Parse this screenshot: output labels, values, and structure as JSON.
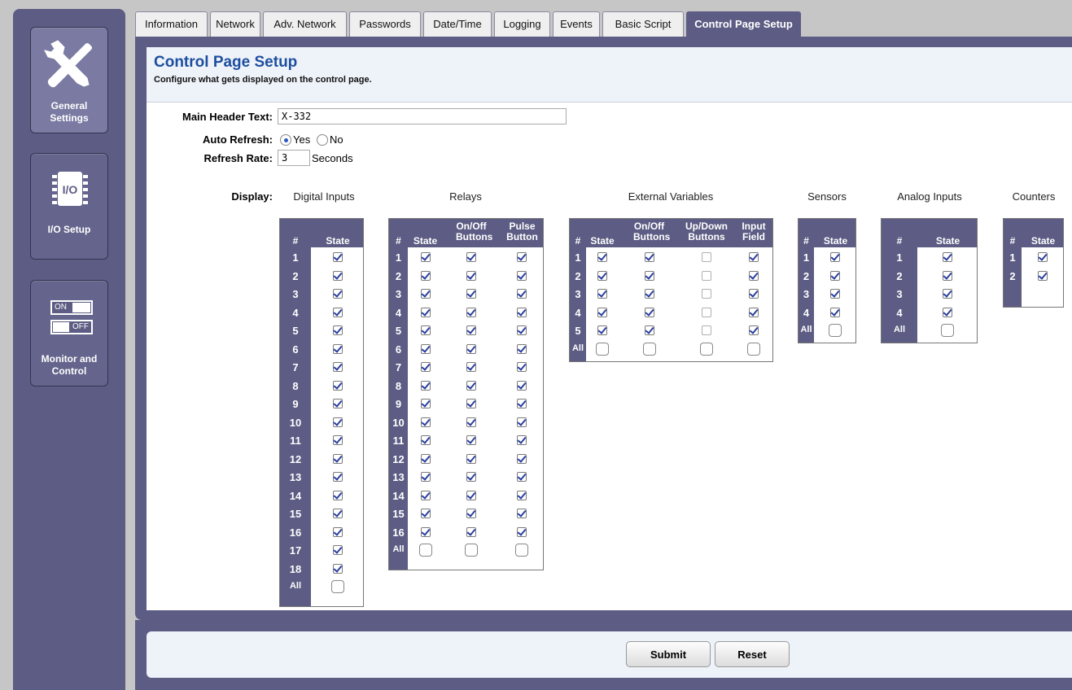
{
  "sidebar": {
    "items": [
      {
        "label": "General Settings",
        "icon": "tools-icon"
      },
      {
        "label": "I/O Setup",
        "icon": "io-chip-icon"
      },
      {
        "label": "Monitor and Control",
        "icon": "on-off-switch-icon",
        "switch_on": "ON",
        "switch_off": "OFF"
      }
    ]
  },
  "tabs": [
    {
      "label": "Information"
    },
    {
      "label": "Network"
    },
    {
      "label": "Adv. Network"
    },
    {
      "label": "Passwords"
    },
    {
      "label": "Date/Time"
    },
    {
      "label": "Logging"
    },
    {
      "label": "Events"
    },
    {
      "label": "Basic Script"
    },
    {
      "label": "Control Page Setup",
      "active": true
    }
  ],
  "page": {
    "title": "Control Page Setup",
    "subtitle": "Configure what gets displayed on the control page."
  },
  "form": {
    "main_header_label": "Main Header Text:",
    "main_header_value": "X-332",
    "auto_refresh_label": "Auto Refresh:",
    "auto_refresh_yes": "Yes",
    "auto_refresh_no": "No",
    "auto_refresh_selected": "Yes",
    "refresh_rate_label": "Refresh Rate:",
    "refresh_rate_value": "3",
    "refresh_rate_unit": "Seconds",
    "display_label": "Display:"
  },
  "groups": {
    "digital_inputs": {
      "title": "Digital Inputs",
      "columns": [
        "#",
        "State"
      ],
      "rows": [
        "1",
        "2",
        "3",
        "4",
        "5",
        "6",
        "7",
        "8",
        "9",
        "10",
        "11",
        "12",
        "13",
        "14",
        "15",
        "16",
        "17",
        "18"
      ],
      "all_label": "All"
    },
    "relays": {
      "title": "Relays",
      "columns": [
        "#",
        "State",
        "On/Off Buttons",
        "Pulse Button"
      ],
      "rows": [
        "1",
        "2",
        "3",
        "4",
        "5",
        "6",
        "7",
        "8",
        "9",
        "10",
        "11",
        "12",
        "13",
        "14",
        "15",
        "16"
      ],
      "all_label": "All"
    },
    "external_variables": {
      "title": "External Variables",
      "columns": [
        "#",
        "State",
        "On/Off Buttons",
        "Up/Down Buttons",
        "Input Field"
      ],
      "rows": [
        "1",
        "2",
        "3",
        "4",
        "5"
      ],
      "all_label": "All"
    },
    "sensors": {
      "title": "Sensors",
      "columns": [
        "#",
        "State"
      ],
      "rows": [
        "1",
        "2",
        "3",
        "4"
      ],
      "all_label": "All"
    },
    "analog_inputs": {
      "title": "Analog Inputs",
      "columns": [
        "#",
        "State"
      ],
      "rows": [
        "1",
        "2",
        "3",
        "4"
      ],
      "all_label": "All"
    },
    "counters": {
      "title": "Counters",
      "columns": [
        "#",
        "State"
      ],
      "rows": [
        "1",
        "2"
      ]
    }
  },
  "footer": {
    "submit_label": "Submit",
    "reset_label": "Reset"
  },
  "colors": {
    "panel": "#5c5c84",
    "title_blue": "#1d4fa0",
    "header_bg": "#eef2f9"
  }
}
